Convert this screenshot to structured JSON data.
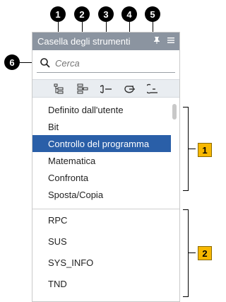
{
  "callouts": {
    "c1": "1",
    "c2": "2",
    "c3": "3",
    "c4": "4",
    "c5": "5",
    "c6": "6"
  },
  "panel": {
    "title": "Casella degli strumenti",
    "pin_icon": "pin-icon",
    "menu_icon": "menu-icon"
  },
  "search": {
    "placeholder": "Cerca",
    "icon": "search-icon"
  },
  "toolbar": {
    "tools": [
      "tree-expand-icon",
      "tree-collapse-icon",
      "plug-icon-1",
      "plug-icon-2",
      "plug-icon-3"
    ]
  },
  "categories": [
    "Definito dall'utente",
    "Bit",
    "Controllo del programma",
    "Matematica",
    "Confronta",
    "Sposta/Copia"
  ],
  "selected_category": "Controllo del programma",
  "items": [
    "RPC",
    "SUS",
    "SYS_INFO",
    "TND"
  ],
  "brackets": {
    "b1": "1",
    "b2": "2"
  },
  "colors": {
    "titlebar": "#8b94a0",
    "selection": "#2a5fa8",
    "label_box": "#f7b800"
  }
}
